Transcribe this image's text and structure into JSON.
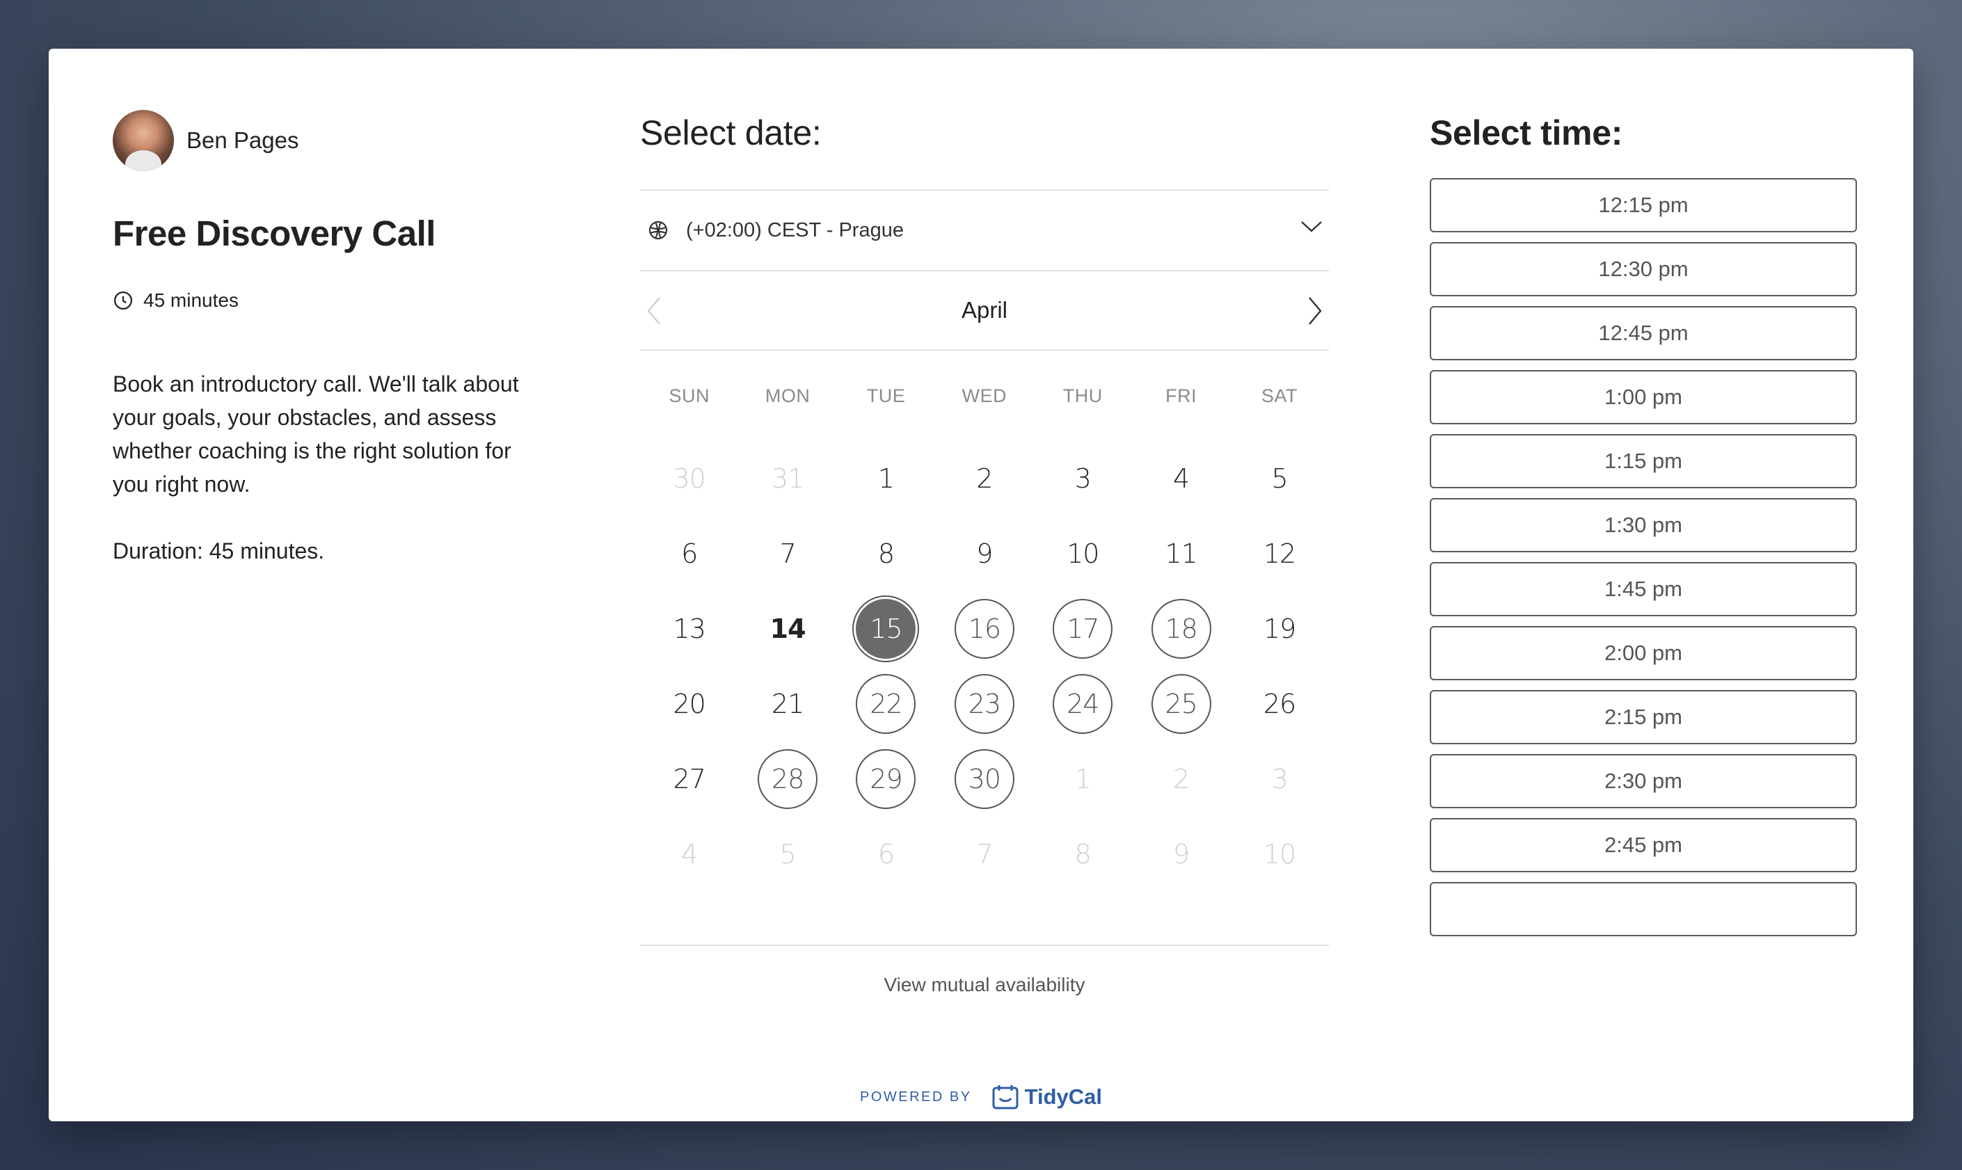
{
  "host": {
    "name": "Ben Pages"
  },
  "event": {
    "title": "Free Discovery Call",
    "duration": "45 minutes",
    "description": "Book an introductory call. We'll talk about your goals, your obstacles, and assess whether coaching is the right solution for you right now.",
    "duration_note": "Duration: 45 minutes."
  },
  "date_picker": {
    "heading": "Select date:",
    "timezone": "(+02:00) CEST - Prague",
    "month": "April",
    "weekdays": [
      "SUN",
      "MON",
      "TUE",
      "WED",
      "THU",
      "FRI",
      "SAT"
    ],
    "days": [
      {
        "d": "30",
        "s": "muted"
      },
      {
        "d": "31",
        "s": "muted"
      },
      {
        "d": "1",
        "s": "normal"
      },
      {
        "d": "2",
        "s": "normal"
      },
      {
        "d": "3",
        "s": "normal"
      },
      {
        "d": "4",
        "s": "normal"
      },
      {
        "d": "5",
        "s": "normal"
      },
      {
        "d": "6",
        "s": "normal"
      },
      {
        "d": "7",
        "s": "normal"
      },
      {
        "d": "8",
        "s": "normal"
      },
      {
        "d": "9",
        "s": "normal"
      },
      {
        "d": "10",
        "s": "normal"
      },
      {
        "d": "11",
        "s": "normal"
      },
      {
        "d": "12",
        "s": "normal"
      },
      {
        "d": "13",
        "s": "normal"
      },
      {
        "d": "14",
        "s": "today"
      },
      {
        "d": "15",
        "s": "selected"
      },
      {
        "d": "16",
        "s": "avail"
      },
      {
        "d": "17",
        "s": "avail"
      },
      {
        "d": "18",
        "s": "avail"
      },
      {
        "d": "19",
        "s": "normal"
      },
      {
        "d": "20",
        "s": "normal"
      },
      {
        "d": "21",
        "s": "normal"
      },
      {
        "d": "22",
        "s": "avail"
      },
      {
        "d": "23",
        "s": "avail"
      },
      {
        "d": "24",
        "s": "avail"
      },
      {
        "d": "25",
        "s": "avail"
      },
      {
        "d": "26",
        "s": "normal"
      },
      {
        "d": "27",
        "s": "normal"
      },
      {
        "d": "28",
        "s": "avail"
      },
      {
        "d": "29",
        "s": "avail"
      },
      {
        "d": "30",
        "s": "avail"
      },
      {
        "d": "1",
        "s": "muted"
      },
      {
        "d": "2",
        "s": "muted"
      },
      {
        "d": "3",
        "s": "muted"
      },
      {
        "d": "4",
        "s": "muted"
      },
      {
        "d": "5",
        "s": "muted"
      },
      {
        "d": "6",
        "s": "muted"
      },
      {
        "d": "7",
        "s": "muted"
      },
      {
        "d": "8",
        "s": "muted"
      },
      {
        "d": "9",
        "s": "muted"
      },
      {
        "d": "10",
        "s": "muted"
      }
    ],
    "mutual_link": "View mutual availability"
  },
  "time_picker": {
    "heading": "Select time:",
    "slots": [
      "12:15 pm",
      "12:30 pm",
      "12:45 pm",
      "1:00 pm",
      "1:15 pm",
      "1:30 pm",
      "1:45 pm",
      "2:00 pm",
      "2:15 pm",
      "2:30 pm",
      "2:45 pm",
      ""
    ]
  },
  "footer": {
    "powered_by": "POWERED BY",
    "brand": "TidyCal"
  },
  "colors": {
    "brand": "#2f5ea8",
    "selected_day": "#6a6a6a"
  }
}
